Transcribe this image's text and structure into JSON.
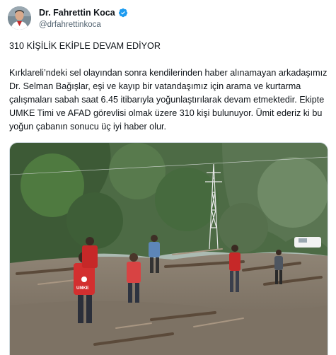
{
  "author": {
    "display_name": "Dr. Fahrettin Koca",
    "handle": "@drfahrettinkoca",
    "verified": true,
    "verified_color": "#1d9bf0"
  },
  "tweet": {
    "headline": "310 KİŞİLİK EKİPLE DEVAM EDİYOR",
    "body": "Kırklareli’ndeki sel olayından sonra kendilerinden haber alınamayan arkadaşımız Dr. Selman Bağışlar, eşi ve kayıp bir vatandaşımız için arama ve kurtarma çalışmaları sabah saat 6.45 itibarıyla yoğunlaştırılarak devam etmektedir. Ekipte UMKE Timi ve AFAD görevlisi olmak üzere 310 kişi bulunuyor. Ümit ederiz ki bu yoğun çabanın sonucu üç iyi haber olur."
  },
  "media": {
    "type": "photo",
    "vest_text": "UMKE"
  }
}
